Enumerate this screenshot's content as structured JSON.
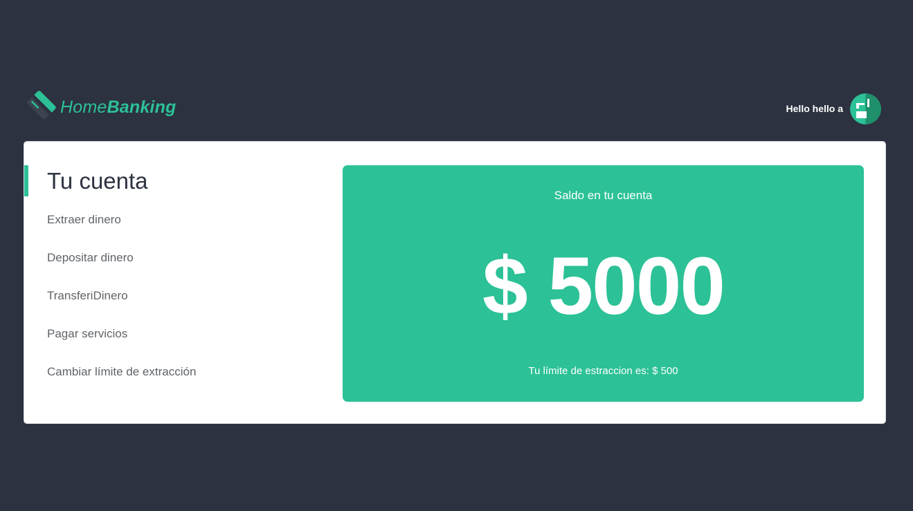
{
  "header": {
    "logo": {
      "text_regular": "Home",
      "text_bold": "Banking",
      "icon": "credit-card-icon"
    },
    "user": {
      "greeting": "Hello hello a",
      "avatar_icon": "user-avatar-icon"
    }
  },
  "sidebar": {
    "title": "Tu cuenta",
    "items": [
      {
        "label": "Extraer dinero"
      },
      {
        "label": "Depositar dinero"
      },
      {
        "label": "TransferiDinero"
      },
      {
        "label": "Pagar servicios"
      },
      {
        "label": "Cambiar límite de extracción"
      }
    ]
  },
  "balance": {
    "label": "Saldo en tu cuenta",
    "amount": "$ 5000",
    "limit_text": "Tu límite de estraccion es: $ 500"
  },
  "colors": {
    "background": "#2c323f",
    "accent": "#2cc197",
    "card": "#ffffff"
  }
}
